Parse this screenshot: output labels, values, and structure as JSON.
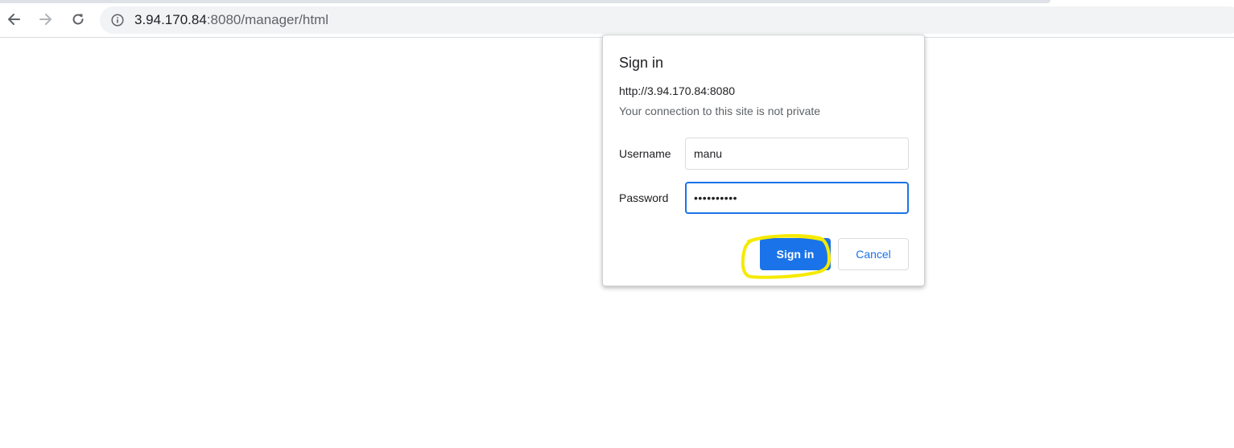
{
  "browser": {
    "url_host": "3.94.170.84",
    "url_rest": ":8080/manager/html",
    "icons": {
      "back": "back-arrow-icon",
      "forward": "forward-arrow-icon",
      "reload": "reload-icon",
      "site_info": "info-icon"
    }
  },
  "dialog": {
    "title": "Sign in",
    "origin": "http://3.94.170.84:8080",
    "warning": "Your connection to this site is not private",
    "username_label": "Username",
    "username_value": "manu",
    "password_label": "Password",
    "password_value": "••••••••••",
    "signin_label": "Sign in",
    "cancel_label": "Cancel"
  },
  "colors": {
    "accent": "#1a73e8",
    "highlight": "#f5ea00"
  }
}
